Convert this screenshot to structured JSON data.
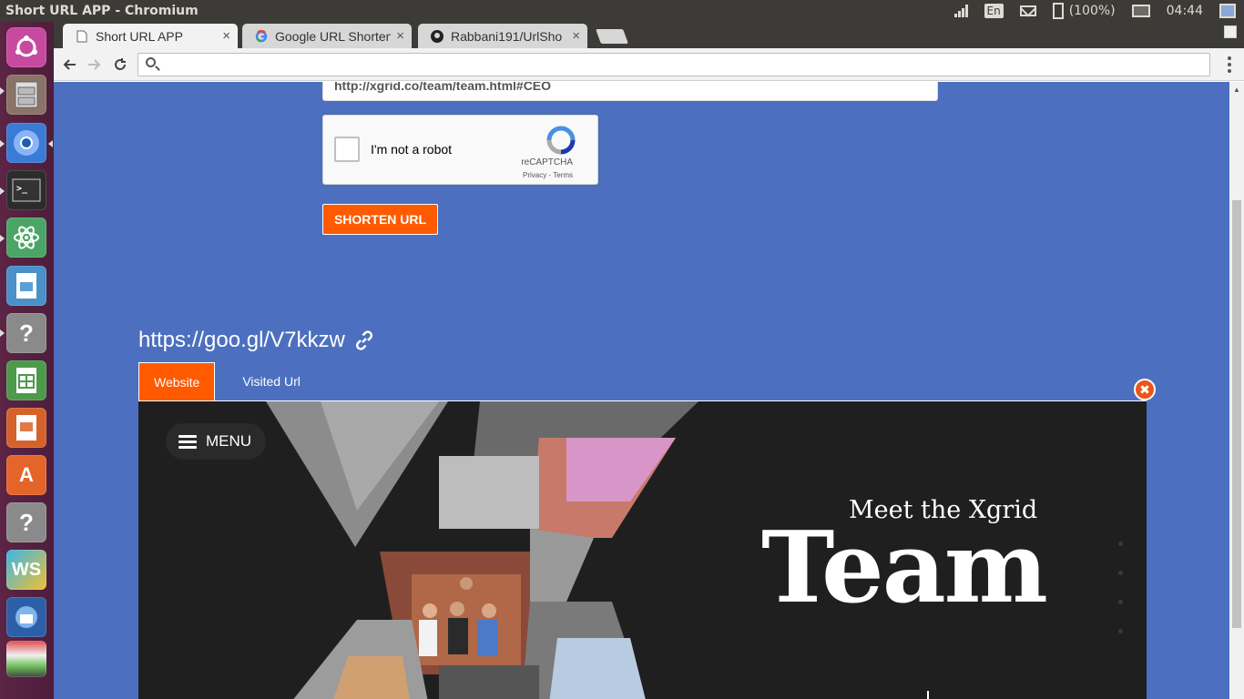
{
  "window": {
    "title": "Short URL APP - Chromium"
  },
  "tray": {
    "language": "En",
    "battery": "(100%)",
    "clock": "04:44"
  },
  "launcher": {
    "apps": [
      "ubuntu-dash-icon",
      "files-icon",
      "chromium-icon",
      "terminal-icon",
      "atom-icon",
      "writer-icon",
      "unknown-app-icon",
      "calc-icon",
      "impress-icon",
      "software-center-icon",
      "unknown-app-icon",
      "webstorm-icon",
      "thunderbird-icon",
      "stack-icon"
    ]
  },
  "browser": {
    "tabs": [
      {
        "label": "Short URL APP",
        "active": true,
        "icon": "page-icon"
      },
      {
        "label": "Google URL Shorten",
        "active": false,
        "icon": "google-icon"
      },
      {
        "label": "Rabbani191/UrlSho",
        "active": false,
        "icon": "github-icon"
      }
    ],
    "close_glyph": "×",
    "address_value": ""
  },
  "form": {
    "url_value": "http://xgrid.co/team/team.html#CEO",
    "captcha_label": "I'm not a robot",
    "captcha_brand": "reCAPTCHA",
    "captcha_terms": "Privacy - Terms",
    "submit_label": "SHORTEN URL"
  },
  "result": {
    "short_url": "https://goo.gl/V7kkzw",
    "tabs": [
      {
        "label": "Website",
        "active": true
      },
      {
        "label": "Visited Url",
        "active": false
      }
    ],
    "close_glyph": "✖"
  },
  "preview": {
    "menu_label": "MENU",
    "subtitle": "Meet the Xgrid",
    "title": "Team"
  },
  "colors": {
    "page_bg": "#4c70bf",
    "accent": "#ff5a00",
    "launcher": "#5c2445",
    "panel": "#3c3b37"
  }
}
